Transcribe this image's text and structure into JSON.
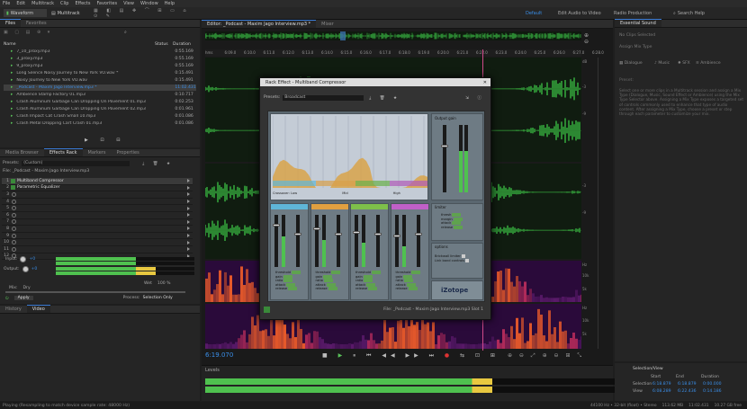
{
  "menu": [
    "File",
    "Edit",
    "Multitrack",
    "Clip",
    "Effects",
    "Favorites",
    "View",
    "Window",
    "Help"
  ],
  "toolbar": {
    "waveform": "Waveform",
    "multitrack": "Multitrack"
  },
  "workspaces": [
    "Default",
    "Edit Audio to Video",
    "Radio Production"
  ],
  "search_label": "Search Help",
  "files_panel": {
    "tabs": [
      "Files",
      "Favorites"
    ],
    "columns": {
      "name": "Name",
      "status": "Status",
      "duration": "Duration"
    },
    "items": [
      {
        "name": "7_10_proxy.mp3",
        "duration": "0:55.169"
      },
      {
        "name": "3_proxy.mp3",
        "duration": "0:55.169"
      },
      {
        "name": "9_proxy.mp3",
        "duration": "0:55.169"
      },
      {
        "name": "Long Silence Noisy Journey to New York VO.wav *",
        "duration": "0:15.491"
      },
      {
        "name": "Noisy Journey to New York VO.wav",
        "duration": "0:15.491"
      },
      {
        "name": "_Podcast - Maxim Jago Interview.mp3 *",
        "duration": "11:02.431"
      },
      {
        "name": "Ambience Stamp Factory 01.mp3",
        "duration": "0:10.717"
      },
      {
        "name": "Crash Aluminum Garbage Can Dropping On Pavement 01.mp3",
        "duration": "0:02.253"
      },
      {
        "name": "Crash Aluminum Garbage Can Dropping On Pavement 02.mp3",
        "duration": "0:01.961"
      },
      {
        "name": "Crash Impact Cat Crash Small 10.mp3",
        "duration": "0:01.086"
      },
      {
        "name": "Crash Metal Dropping Cart Crash 01.mp3",
        "duration": "0:01.086"
      }
    ]
  },
  "effects_panel": {
    "tabs": [
      "Media Browser",
      "Effects Rack",
      "Markers",
      "Properties"
    ],
    "presets_label": "Presets:",
    "preset_value": "(Custom)",
    "file_label": "File: _Podcast - Maxim Jago Interview.mp3",
    "slots": [
      {
        "num": "1",
        "name": "Multiband Compressor"
      },
      {
        "num": "2",
        "name": "Parametric Equalizer"
      },
      {
        "num": "3",
        "name": ""
      },
      {
        "num": "4",
        "name": ""
      },
      {
        "num": "5",
        "name": ""
      },
      {
        "num": "6",
        "name": ""
      },
      {
        "num": "7",
        "name": ""
      },
      {
        "num": "8",
        "name": ""
      },
      {
        "num": "9",
        "name": ""
      },
      {
        "num": "10",
        "name": ""
      },
      {
        "num": "11",
        "name": ""
      },
      {
        "num": "12",
        "name": ""
      }
    ],
    "input_label": "Input:",
    "output_label": "Output:",
    "input_val": "+0",
    "output_val": "+0",
    "wet_label": "Wet",
    "wet_val": "100 %",
    "mix_label": "Mix:",
    "dry_label": "Dry",
    "apply": "Apply",
    "process_label": "Process:",
    "process_val": "Selection Only"
  },
  "bottom_left_tabs": [
    "History",
    "Video"
  ],
  "editor": {
    "tab": "Editor: _Podcast - Maxim Jago Interview.mp3 *",
    "tab2": "Mixer",
    "ruler": [
      "hms",
      "6:09.0",
      "6:10.0",
      "6:11.0",
      "6:12.0",
      "6:13.0",
      "6:14.0",
      "6:15.0",
      "6:16.0",
      "6:17.0",
      "6:18.0",
      "6:19.0",
      "6:20.0",
      "6:21.0",
      "6:22.0",
      "6:23.0",
      "6:24.0",
      "6:25.0",
      "6:26.0",
      "6:27.0",
      "6:28.0"
    ],
    "time": "6:19.070",
    "levels_label": "Levels",
    "db_right": [
      "dB",
      "-3",
      "-9",
      "-3",
      "-9",
      "Hz",
      "10k",
      "5k",
      "Hz",
      "10k",
      "5k"
    ]
  },
  "dialog": {
    "title": "Rack Effect - Multiband Compressor",
    "presets_label": "Presets:",
    "preset_value": "Broadcast",
    "output_gain": "Output gain",
    "crossover_low": "Crossover: Low",
    "mid": "Mid",
    "high": "High",
    "limiter": "limiter",
    "options": "options",
    "band_labels": [
      "threshold",
      "gain",
      "ratio",
      "attack",
      "release"
    ],
    "limiter_labels": [
      "thresh",
      "margin",
      "attack",
      "release"
    ],
    "option_items": [
      "Brickwall limiter",
      "Link band controls"
    ],
    "footer": "File: _Podcast - Maxim Jago Interview.mp3   Slot 1",
    "logo": "iZotope"
  },
  "essential_sound": {
    "title": "Essential Sound",
    "no_clips": "No Clips Selected",
    "assign": "Assign Mix Type",
    "types": [
      "Dialogue",
      "Music",
      "SFX",
      "Ambience"
    ],
    "preset": "Preset:",
    "help": "Select one or more clips in a Multitrack session and assign a Mix Type (Dialogue, Music, Sound Effect or Ambience) using the Mix Type Selector above. Assigning a Mix Type exposes a targeted set of controls commonly used to enhance that type of audio content. After assigning a Mix Type, choose a preset or step through each parameter to customize your mix."
  },
  "selection": {
    "title": "Selection/View",
    "cols": [
      "Start",
      "End",
      "Duration"
    ],
    "rows": [
      {
        "label": "Selection",
        "start": "6:18.879",
        "end": "6:18.879",
        "dur": "0:00.000"
      },
      {
        "label": "View",
        "start": "6:08.289",
        "end": "6:22.436",
        "dur": "0:14.186"
      }
    ]
  },
  "status": {
    "left": "Playing (Resampling to match device sample rate: 48000 Hz)",
    "right": [
      "44100 Hz • 32-bit (float) • Stereo",
      "113.62 MB",
      "11:02.431",
      "10.27 GB free"
    ]
  }
}
